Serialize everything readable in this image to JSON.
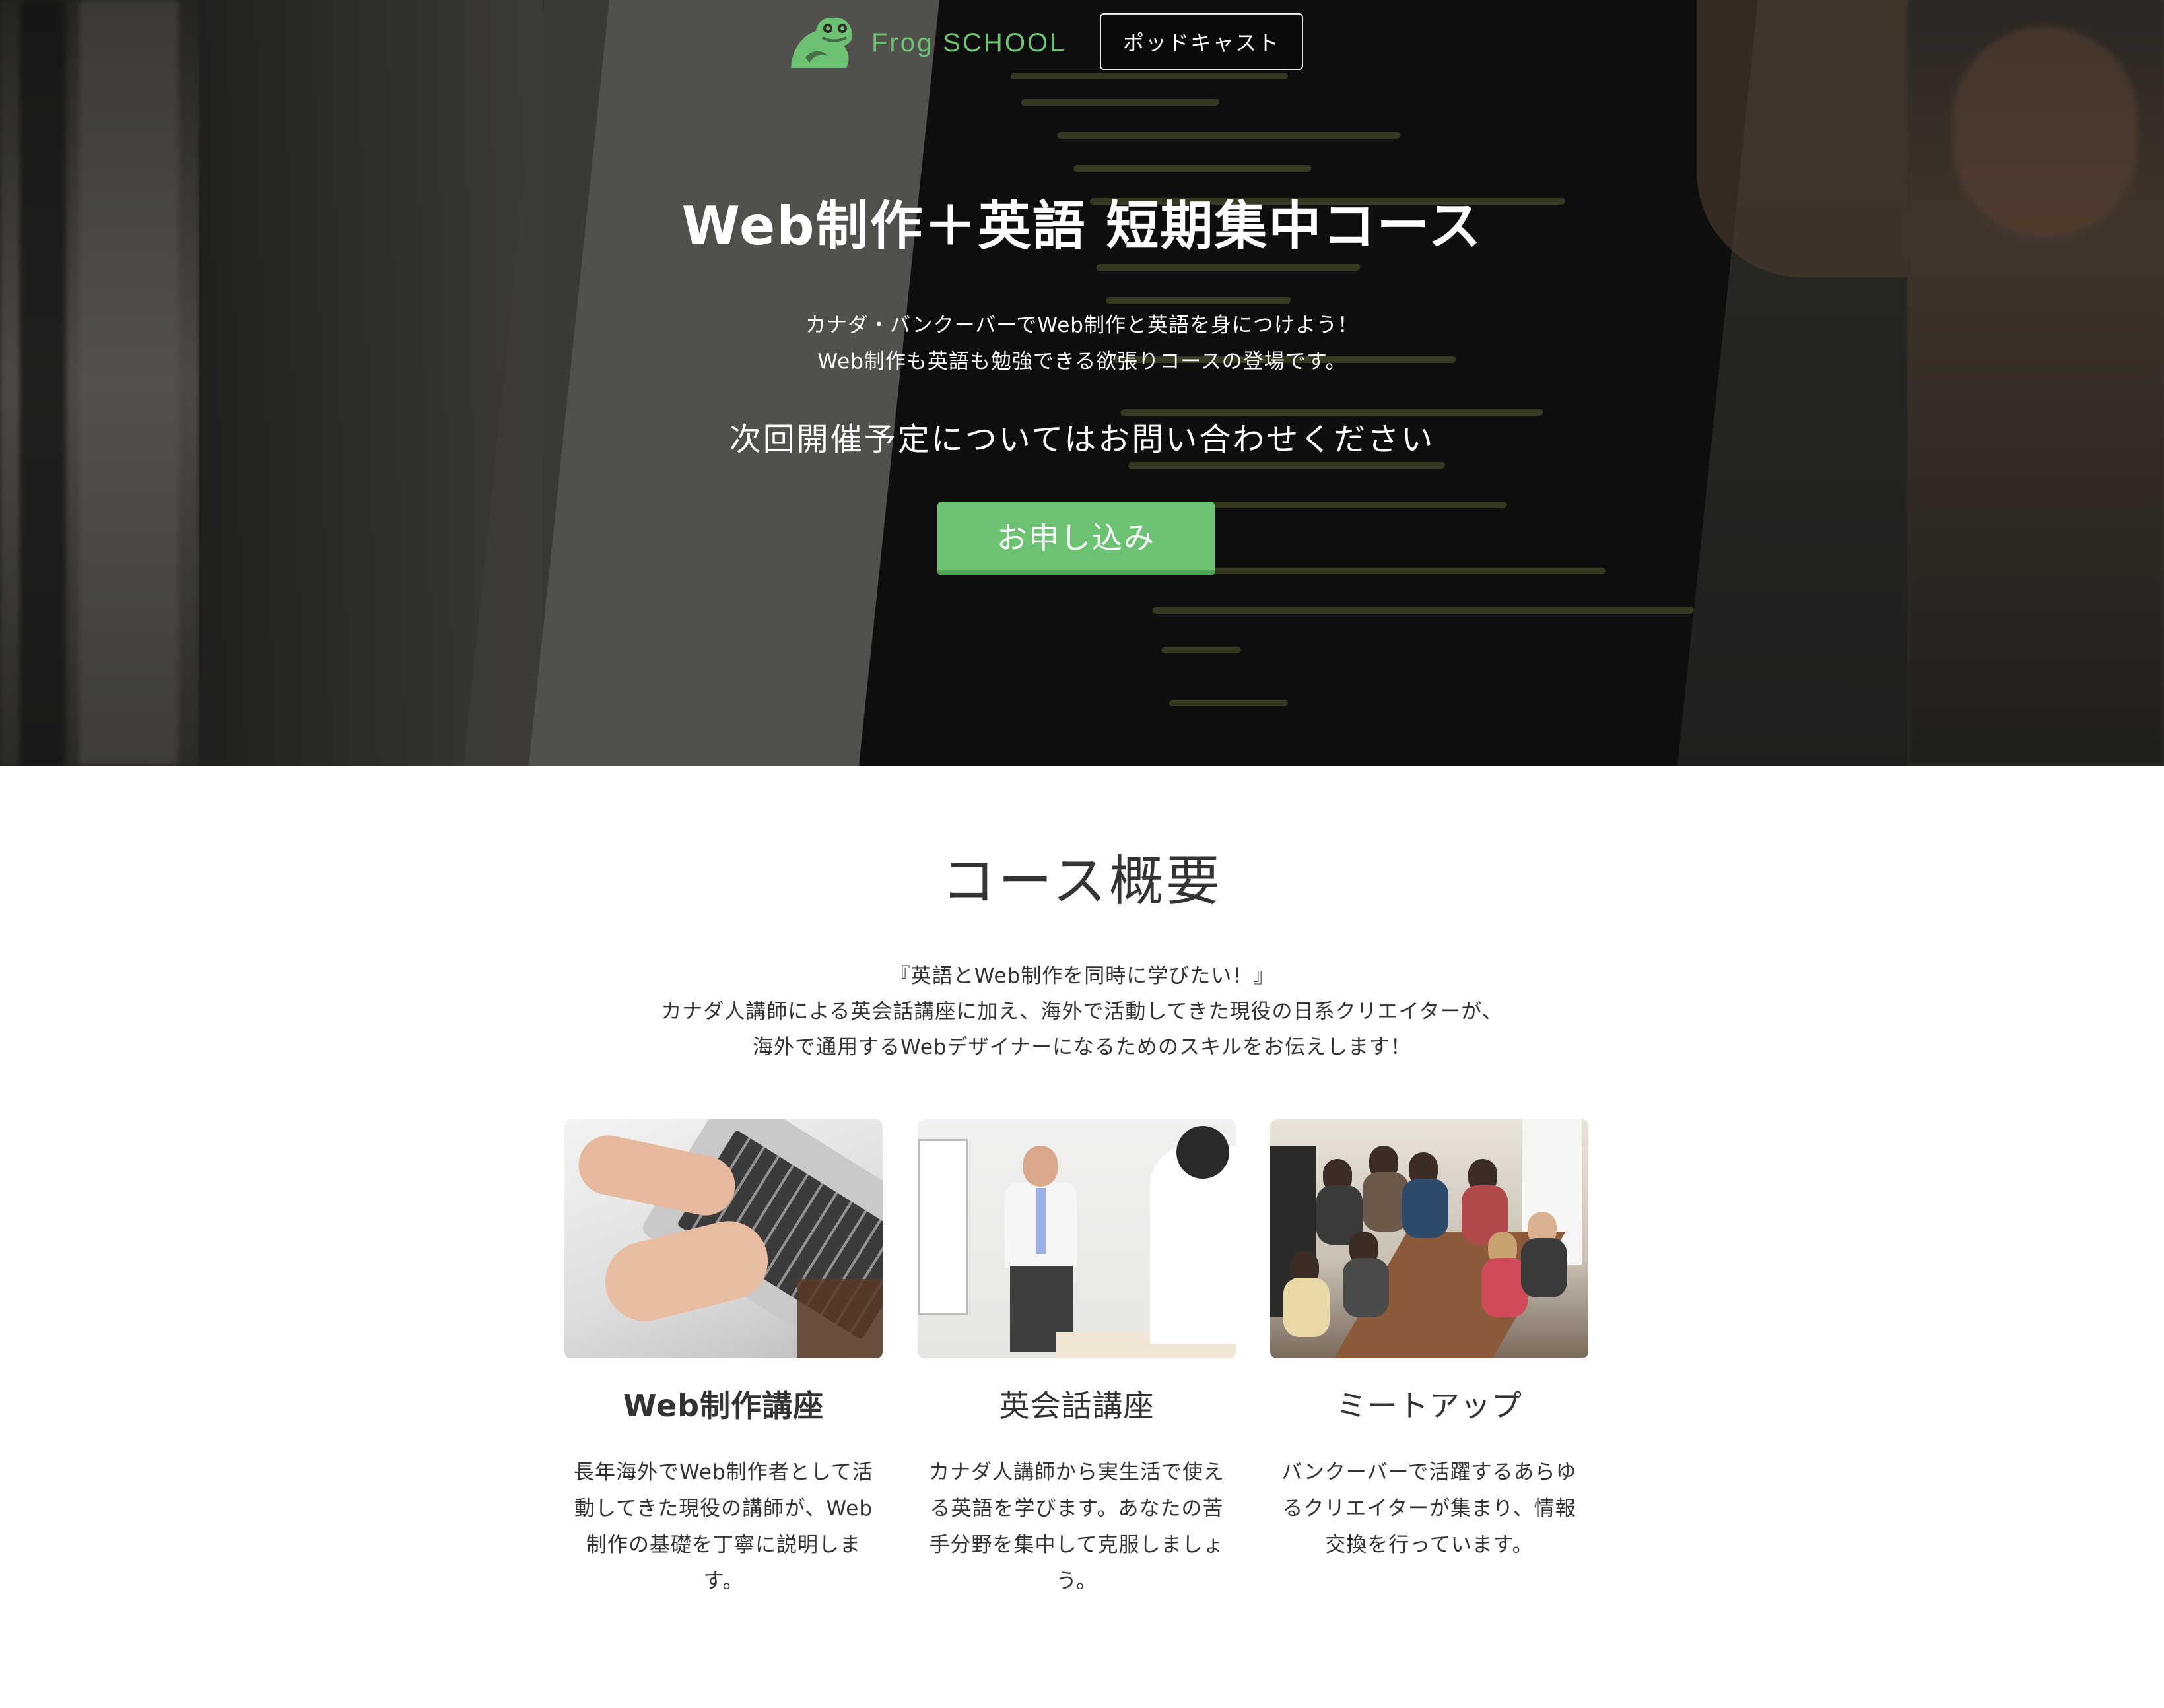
{
  "header": {
    "brand": "Frog SCHOOL",
    "logo_icon": "frog-icon",
    "podcast_label": "ポッドキャスト"
  },
  "hero": {
    "title": "Web制作＋英語 短期集中コース",
    "lead_line1": "カナダ・バンクーバーでWeb制作と英語を身につけよう！",
    "lead_line2": "Web制作も英語も勉強できる欲張りコースの登場です。",
    "next_session": "次回開催予定についてはお問い合わせください",
    "apply_label": "お申し込み"
  },
  "overview": {
    "title": "コース概要",
    "intro_line1": "『英語とWeb制作を同時に学びたい！』",
    "intro_line2": "カナダ人講師による英会話講座に加え、海外で活動してきた現役の日系クリエイターが、",
    "intro_line3": "海外で通用するWebデザイナーになるためのスキルをお伝えします！",
    "cards": [
      {
        "title": "Web制作講座",
        "text": "長年海外でWeb制作者として活動してきた現役の講師が、Web制作の基礎を丁寧に説明します。"
      },
      {
        "title": "英会話講座",
        "text": "カナダ人講師から実生活で使える英語を学びます。あなたの苦手分野を集中して克服しましょう。"
      },
      {
        "title": "ミートアップ",
        "text": "バンクーバーで活躍するあらゆるクリエイターが集まり、情報交換を行っています。"
      }
    ]
  },
  "colors": {
    "accent_green": "#6cc172",
    "button_shadow_green": "#4fa456",
    "text": "#333333"
  }
}
